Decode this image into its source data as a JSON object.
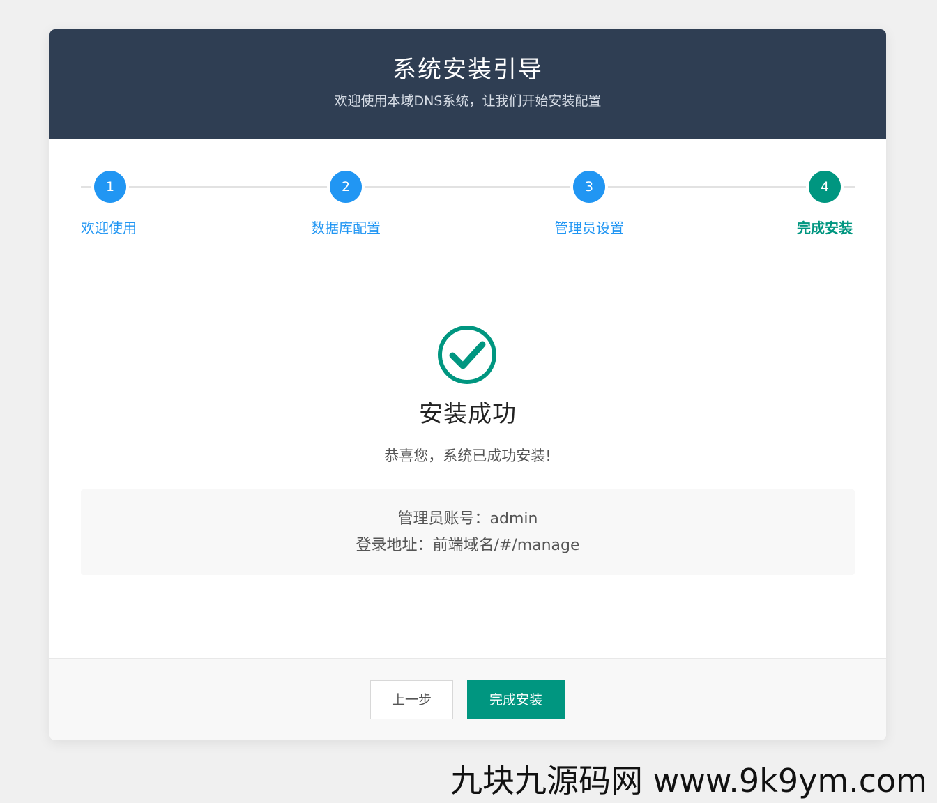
{
  "header": {
    "title": "系统安装引导",
    "subtitle": "欢迎使用本域DNS系统，让我们开始安装配置"
  },
  "steps": [
    {
      "number": "1",
      "label": "欢迎使用"
    },
    {
      "number": "2",
      "label": "数据库配置"
    },
    {
      "number": "3",
      "label": "管理员设置"
    },
    {
      "number": "4",
      "label": "完成安装"
    }
  ],
  "active_step": 4,
  "success": {
    "icon": "check-circle-icon",
    "title": "安装成功",
    "message": "恭喜您，系统已成功安装!"
  },
  "info": {
    "admin_account": "管理员账号：admin",
    "login_url": "登录地址：前端域名/#/manage"
  },
  "buttons": {
    "prev": "上一步",
    "finish": "完成安装"
  },
  "watermark": "九块九源码网 www.9k9ym.com",
  "colors": {
    "header_bg": "#2f3e53",
    "step_blue": "#2196f3",
    "success_green": "#009680"
  }
}
